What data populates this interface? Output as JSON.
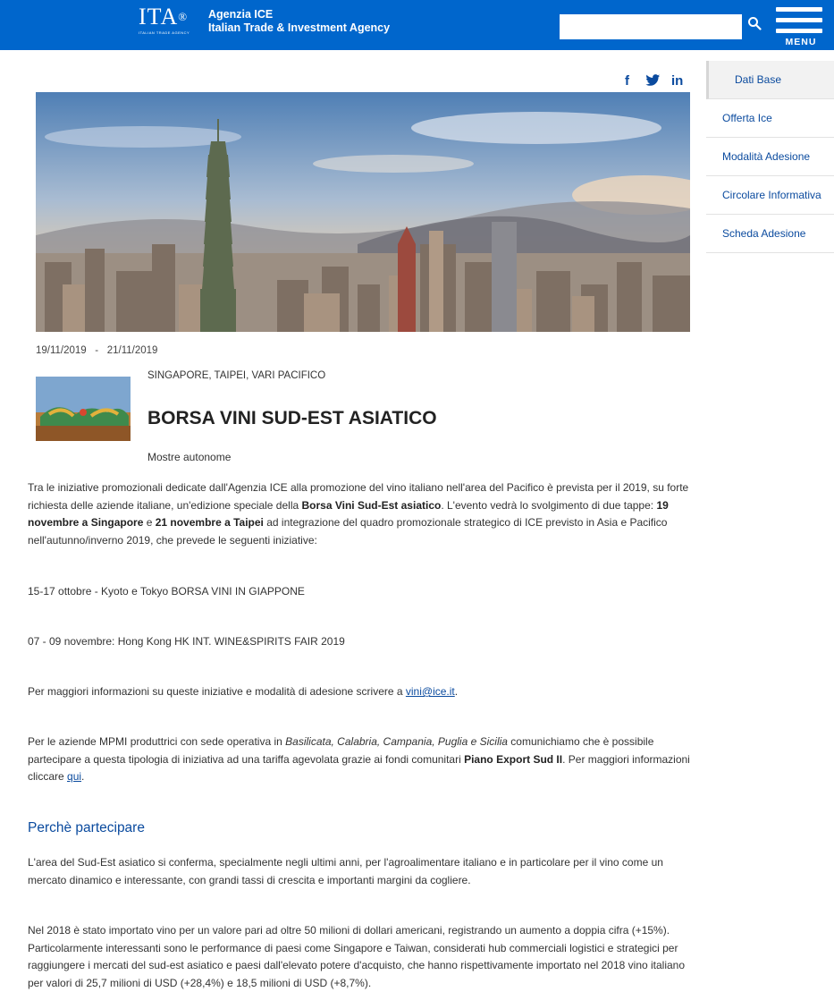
{
  "header": {
    "logo_text": "ITA",
    "logo_mark": "®",
    "logo_sub": "ITALIAN TRADE AGENCY",
    "agency_line1": "Agenzia ICE",
    "agency_line2": "Italian Trade & Investment Agency",
    "search_value": "",
    "menu_label": "MENU",
    "colors": {
      "bar": "#0066cc"
    }
  },
  "social": {
    "facebook": "f",
    "twitter": "twitter-icon",
    "linkedin": "in"
  },
  "sidebar": {
    "items": [
      {
        "label": "Dati Base",
        "active": true
      },
      {
        "label": "Offerta Ice"
      },
      {
        "label": "Modalità Adesione"
      },
      {
        "label": "Circolare Informativa"
      },
      {
        "label": "Scheda Adesione"
      }
    ]
  },
  "event": {
    "date_start": "19/11/2019",
    "date_sep": "-",
    "date_end": "21/11/2019",
    "location": "SINGAPORE, TAIPEI, VARI PACIFICO",
    "title": "BORSA VINI SUD-EST ASIATICO",
    "category": "Mostre autonome"
  },
  "content": {
    "p1_a": "Tra le iniziative promozionali dedicate dall'Agenzia ICE alla promozione del vino italiano nell'area del Pacifico è prevista per il 2019, su forte richiesta delle aziende italiane, un'edizione speciale della ",
    "p1_b": "Borsa Vini Sud-Est asiatico",
    "p1_c": ". L'evento vedrà lo svolgimento di due tappe: ",
    "p1_d": "19 novembre a Singapore",
    "p1_e": " e ",
    "p1_f": "21 novembre a Taipei",
    "p1_g": " ad integrazione del quadro promozionale strategico di ICE previsto in Asia e Pacifico nell'autunno/inverno 2019, che prevede le seguenti iniziative:",
    "p2": "15-17 ottobre - Kyoto e Tokyo BORSA VINI IN GIAPPONE",
    "p3": "07 - 09 novembre: Hong Kong HK INT. WINE&SPIRITS FAIR 2019",
    "p4_a": "Per maggiori informazioni su queste iniziative e modalità di adesione scrivere a ",
    "p4_link": "vini@ice.it",
    "p4_b": ".",
    "p5_a": "Per le aziende MPMI produttrici con sede operativa in ",
    "p5_regions": "Basilicata, Calabria, Campania, Puglia e Sicilia",
    "p5_b": " comunichiamo che è possibile partecipare a questa tipologia di iniziativa ad una tariffa agevolata grazie ai fondi comunitari ",
    "p5_fund": "Piano Export Sud II",
    "p5_c": ". Per maggiori informazioni cliccare ",
    "p5_link": "qui",
    "p5_d": ".",
    "section_title": "Perchè partecipare",
    "p6": "L'area del Sud-Est asiatico si conferma, specialmente negli ultimi anni, per l'agroalimentare italiano e in particolare per il vino come un mercato dinamico e interessante, con grandi tassi di crescita e importanti margini da cogliere.",
    "p7": "Nel 2018 è stato importato vino per un valore pari ad oltre 50 milioni di dollari americani, registrando un aumento a doppia cifra (+15%). Particolarmente interessanti sono le performance di paesi come Singapore e Taiwan, considerati hub commerciali logistici e strategici per raggiungere i mercati del sud-est asiatico e paesi dall'elevato potere d'acquisto, che hanno rispettivamente importato nel 2018 vino italiano per valori di 25,7 milioni di USD (+28,4%) e 18,5 milioni di USD (+8,7%)."
  }
}
